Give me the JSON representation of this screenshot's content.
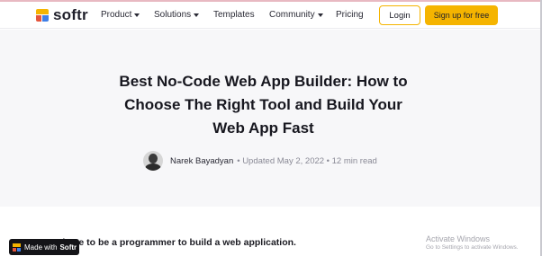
{
  "brand": {
    "name": "softr"
  },
  "nav": {
    "items": [
      {
        "label": "Product",
        "dropdown": true
      },
      {
        "label": "Solutions",
        "dropdown": true
      },
      {
        "label": "Templates",
        "dropdown": false
      },
      {
        "label": "Community",
        "dropdown": true
      },
      {
        "label": "Pricing",
        "dropdown": false
      }
    ],
    "login_label": "Login",
    "signup_label": "Sign up for free"
  },
  "article": {
    "title": "Best No-Code Web App Builder: How to Choose The Right Tool and Build Your Web App Fast",
    "author": "Narek Bayadyan",
    "meta": "• Updated May 2, 2022 • 12 min read",
    "intro": "’t have to be a programmer to build a web application."
  },
  "badge": {
    "prefix": "Made with",
    "brand": "Softr"
  },
  "watermark": {
    "title": "Activate Windows",
    "subtitle": "Go to Settings to activate Windows."
  },
  "colors": {
    "accent": "#f5b400",
    "logo_red": "#e5553c",
    "logo_blue": "#3f7fe6",
    "hero_background": "#f7f7f9"
  }
}
